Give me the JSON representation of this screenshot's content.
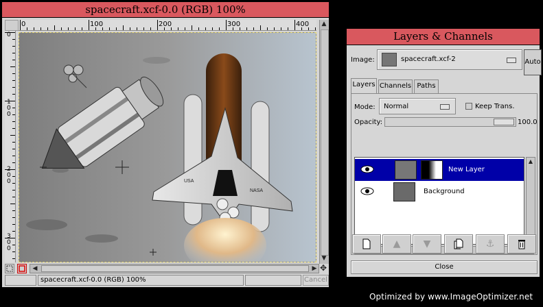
{
  "image_window": {
    "title": "spacecraft.xcf-0.0 (RGB) 100%",
    "ruler_h_labels": [
      "0",
      "100",
      "200",
      "300",
      "400"
    ],
    "ruler_v_labels": [
      "0",
      "100",
      "200",
      "300"
    ],
    "status_text": "spacecraft.xcf-0.0 (RGB) 100%",
    "cancel_label": "Cancel"
  },
  "layers_dialog": {
    "title": "Layers & Channels",
    "image_label": "Image:",
    "image_value": "spacecraft.xcf-2",
    "auto_label": "Auto",
    "tabs": [
      {
        "label": "Layers",
        "active": true
      },
      {
        "label": "Channels",
        "active": false
      },
      {
        "label": "Paths",
        "active": false
      }
    ],
    "mode_label": "Mode:",
    "mode_value": "Normal",
    "keep_trans_label": "Keep Trans.",
    "opacity_label": "Opacity:",
    "opacity_value": "100.0",
    "layers": [
      {
        "name": "New Layer",
        "selected": true,
        "visible": true
      },
      {
        "name": "Background",
        "selected": false,
        "visible": true
      }
    ],
    "close_label": "Close"
  },
  "watermark": "Optimized by  www.ImageOptimizer.net",
  "colors": {
    "titlebar": "#d9585e",
    "selection": "#0000a8"
  }
}
